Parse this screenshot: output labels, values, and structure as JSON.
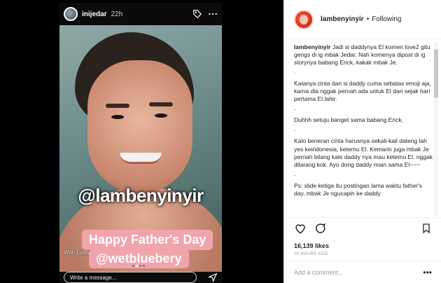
{
  "story": {
    "username": "inijedar",
    "time": "22h",
    "handle_overlay": "@lambenyinyir",
    "sticker_line1": "Happy Father's Day",
    "sticker_line2": "@wetbluebery",
    "with_label": "With Ludwig",
    "message_placeholder": "Write a message...",
    "icons": [
      "tag-icon",
      "more-icon",
      "share-icon"
    ]
  },
  "post": {
    "username": "lambenyinyir",
    "separator": "•",
    "follow_state": "Following",
    "caption": {
      "author": "lambenyinyir",
      "lines": [
        "Jadi si daddynya El komen love2 gitu gengs di ig mbak Jedar. Nah komenya dipost di ig storynya babang Erick, kakak mbak Je.",
        ".",
        "Katanya cinta dari si daddy cuma sebatas emoji aja, karna dia nggak pernah ada untuk El dari sejak hari pertama El lahir.",
        ".",
        "Duhhh setuju banget sama babang Erick.",
        ".",
        "Kalo beneran cinta harusnya sekali-kali dateng lah yes keindonesia, ketemu El. Kemarin juga mbak Je pernah bilang kalo daddy nya mau ketemu El. nggak dilarang kok. Ayo dong daddy main sama El~~~",
        ".",
        "Ps: slide ketiga itu postingan lama waktu father's day, mbak Je ngucapin ke daddy"
      ]
    },
    "likes": "16,139 likes",
    "time_ago": "20 HOURS AGO",
    "comment_placeholder": "Add a comment...",
    "more": "•••"
  }
}
